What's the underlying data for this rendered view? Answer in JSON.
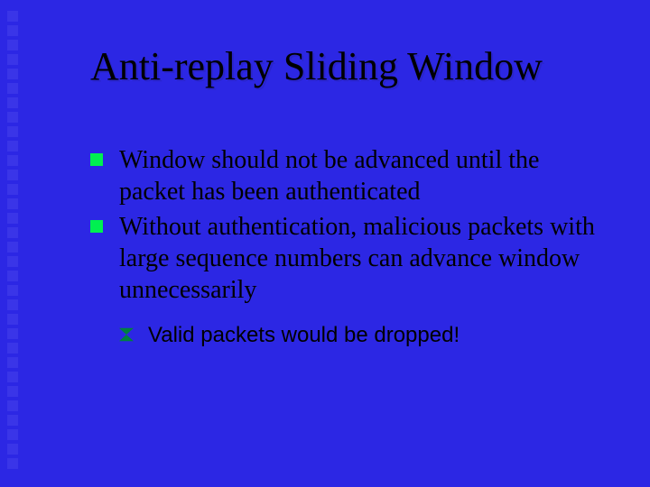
{
  "title": "Anti-replay Sliding Window",
  "bullets": {
    "b0": "Window should not be advanced until the packet has been authenticated",
    "b1": "Without authentication, malicious packets with large sequence numbers can advance window unnecessarily",
    "sub0": "Valid packets would be dropped!"
  }
}
